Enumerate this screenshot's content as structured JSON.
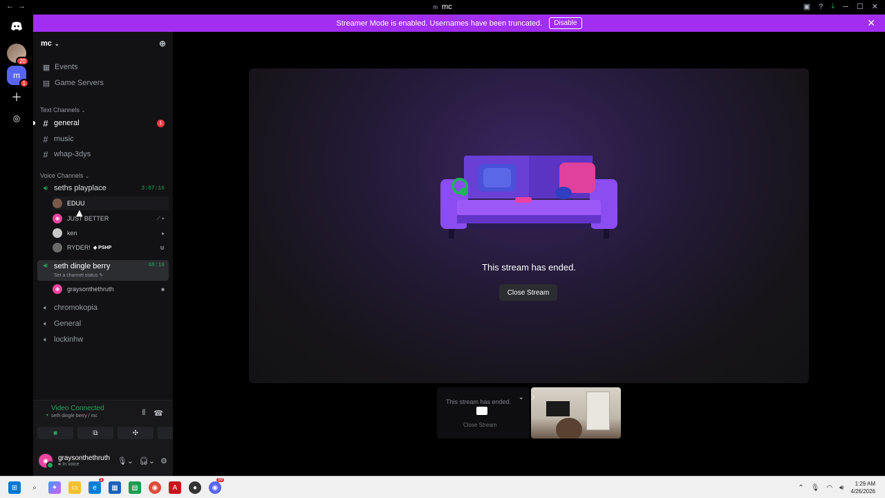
{
  "window": {
    "title": "mc",
    "title_prefix": "m"
  },
  "banner": {
    "text": "Streamer Mode is enabled. Usernames have been truncated.",
    "disable_label": "Disable"
  },
  "rail": {
    "badge_server1": "20",
    "badge_server2": "1",
    "server2_initial": "m"
  },
  "server": {
    "name": "mc"
  },
  "sidebar": {
    "events": "Events",
    "game_servers": "Game Servers",
    "text_category": "Text Channels",
    "text_channels": [
      {
        "name": "general",
        "badge": "1"
      },
      {
        "name": "music"
      },
      {
        "name": "whap-3dys"
      }
    ],
    "voice_category": "Voice Channels",
    "voice_channels": [
      {
        "name": "seths playplace",
        "timer": "3:07:16"
      },
      {
        "name": "seth dingle berry",
        "timer": "48:16",
        "status": "Set a channel status"
      },
      {
        "name": "chromokopia"
      },
      {
        "name": "General"
      },
      {
        "name": "lockinhw"
      }
    ],
    "members_playplace": [
      {
        "name": "EDUU"
      },
      {
        "name": "JUST BETTER"
      },
      {
        "name": "ken"
      },
      {
        "name": "RYDER!",
        "tag": "PSHP"
      }
    ],
    "members_dingle": [
      {
        "name": "graysonthethruth"
      }
    ]
  },
  "voice_panel": {
    "status": "Video Connected",
    "location": "seth dingle berry / mc"
  },
  "user": {
    "name": "graysonthethruth",
    "status": "In voice"
  },
  "stage": {
    "ended_text": "This stream has ended.",
    "close_label": "Close Stream"
  },
  "thumb": {
    "ended_text": "This stream has ended.",
    "close_label": "Close Stream"
  },
  "taskbar": {
    "time": "1:29 AM",
    "date": "4/26/2026",
    "app_badge_red": "1",
    "app_badge_discord": "99"
  },
  "colors": {
    "banner": "#a22ef2",
    "voice_green": "#23a55a",
    "badge_red": "#f23f43"
  }
}
